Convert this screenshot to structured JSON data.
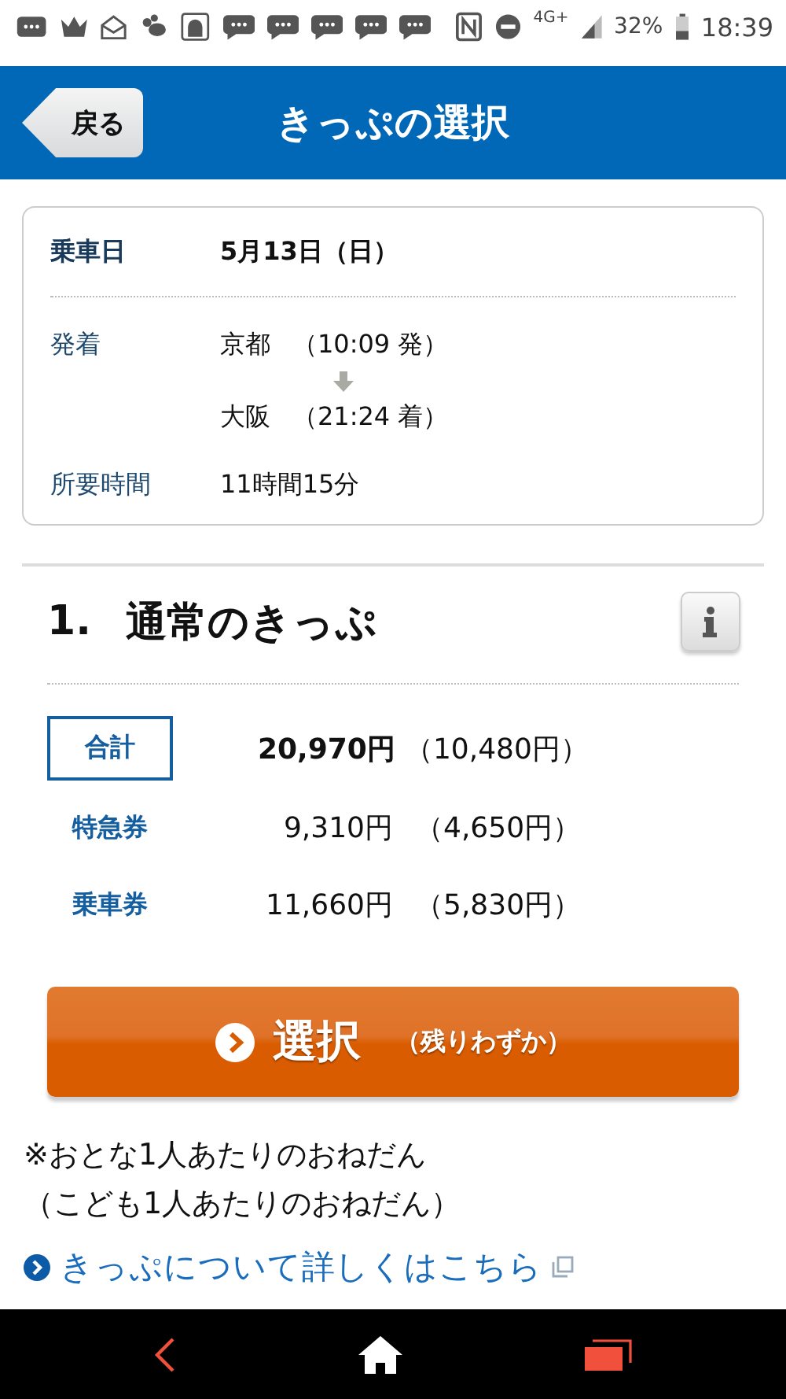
{
  "status_bar": {
    "network": "4G+",
    "battery": "32%",
    "time": "18:39"
  },
  "header": {
    "back_button": "戻る",
    "title": "きっぷの選択"
  },
  "trip": {
    "date_label": "乗車日",
    "date": "5月13日（日）",
    "route_label": "発着",
    "departure": {
      "station": "京都",
      "time": "（10:09 発）"
    },
    "arrival": {
      "station": "大阪",
      "time": "（21:24 着）"
    },
    "duration_label": "所要時間",
    "duration": "11時間15分"
  },
  "fare": {
    "number": "1.",
    "title": "通常のきっぷ",
    "rows": [
      {
        "kind": "total",
        "label": "合計",
        "adult": "20,970円",
        "child": "（10,480円）"
      },
      {
        "kind": "item",
        "label": "特急券",
        "adult": "9,310円",
        "child": "（4,650円）"
      },
      {
        "kind": "item",
        "label": "乗車券",
        "adult": "11,660円",
        "child": "（5,830円）"
      }
    ],
    "select_button": {
      "label": "選択",
      "note": "（残りわずか）"
    },
    "notes": [
      "※おとな1人あたりのおねだん",
      "（こども1人あたりのおねだん）"
    ],
    "link": "きっぷについて詳しくはこちら"
  }
}
